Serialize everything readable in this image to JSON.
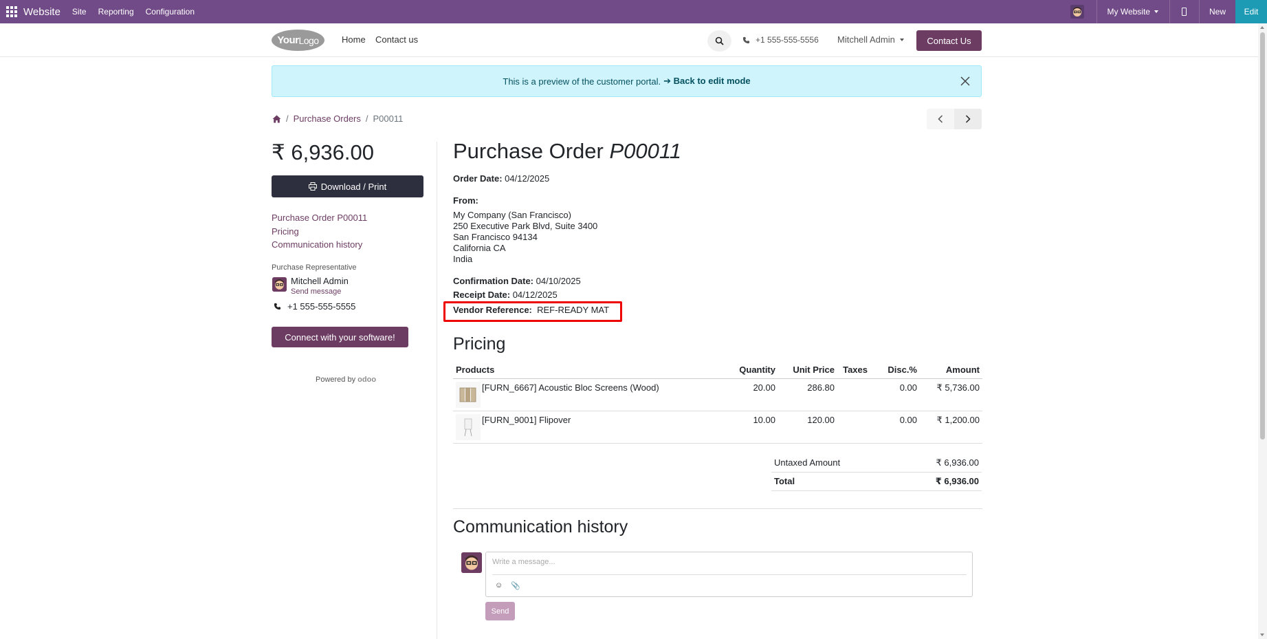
{
  "adminbar": {
    "app_name": "Website",
    "menu": [
      "Site",
      "Reporting",
      "Configuration"
    ],
    "website_selector": "My Website",
    "new_label": "New",
    "edit_label": "Edit",
    "accent": "#714b87"
  },
  "header": {
    "logo_text": "Your",
    "logo_text2": "Logo",
    "nav": [
      "Home",
      "Contact us"
    ],
    "phone": "+1 555-555-5556",
    "user": "Mitchell Admin",
    "contact_button": "Contact Us"
  },
  "alert": {
    "text": "This is a preview of the customer portal.",
    "link": "➔ Back to edit mode"
  },
  "breadcrumb": {
    "items": [
      "Purchase Orders",
      "P00011"
    ]
  },
  "sidebar": {
    "amount": "₹ 6,936.00",
    "download_label": "Download / Print",
    "toc": [
      "Purchase Order P00011",
      "Pricing",
      "Communication history"
    ],
    "rep_label": "Purchase Representative",
    "rep_name": "Mitchell Admin",
    "rep_send": "Send message",
    "rep_phone": "+1 555-555-5555",
    "connect_label": "Connect with your software!",
    "powered_by": "Powered by",
    "powered_brand": "odoo"
  },
  "order": {
    "title_prefix": "Purchase Order",
    "title_ref": "P00011",
    "order_date_label": "Order Date:",
    "order_date": "04/12/2025",
    "from_label": "From:",
    "address": [
      "My Company (San Francisco)",
      "250 Executive Park Blvd, Suite 3400",
      "San Francisco 94134",
      "California CA",
      "India"
    ],
    "confirmation_label": "Confirmation Date:",
    "confirmation_date": "04/10/2025",
    "receipt_label": "Receipt Date:",
    "receipt_date": "04/12/2025",
    "vendor_ref_label": "Vendor Reference:",
    "vendor_ref": "REF-READY MAT"
  },
  "pricing": {
    "heading": "Pricing",
    "columns": [
      "Products",
      "Quantity",
      "Unit Price",
      "Taxes",
      "Disc.%",
      "Amount"
    ],
    "rows": [
      {
        "product": "[FURN_6667] Acoustic Bloc Screens (Wood)",
        "qty": "20.00",
        "unit_price": "286.80",
        "taxes": "",
        "disc": "0.00",
        "amount": "₹ 5,736.00"
      },
      {
        "product": "[FURN_9001] Flipover",
        "qty": "10.00",
        "unit_price": "120.00",
        "taxes": "",
        "disc": "0.00",
        "amount": "₹ 1,200.00"
      }
    ],
    "untaxed_label": "Untaxed Amount",
    "untaxed_value": "₹ 6,936.00",
    "total_label": "Total",
    "total_value": "₹ 6,936.00"
  },
  "chatter": {
    "heading": "Communication history",
    "placeholder": "Write a message...",
    "send_label": "Send"
  }
}
